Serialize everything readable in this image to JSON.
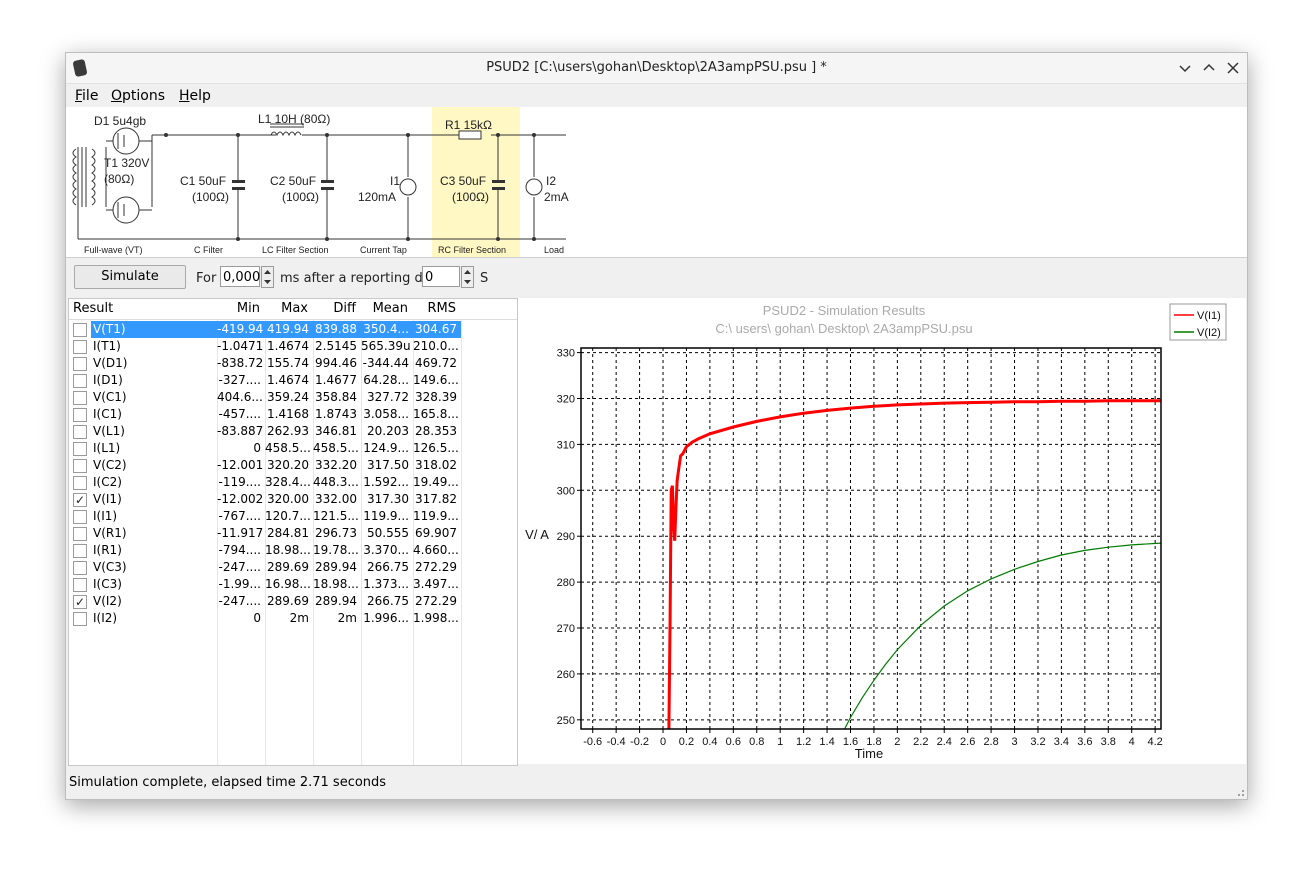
{
  "window": {
    "title": "PSUD2 [C:\\users\\gohan\\Desktop\\2A3ampPSU.psu ] *"
  },
  "menu": [
    {
      "label": "File",
      "mnemonic": "F",
      "rest": "ile"
    },
    {
      "label": "Options",
      "mnemonic": "O",
      "rest": "ptions"
    },
    {
      "label": "Help",
      "mnemonic": "H",
      "rest": "elp"
    }
  ],
  "circuit": {
    "components": {
      "d1": "D1 5u4gb",
      "t1": "T1 320V",
      "t1_r": "(80Ω)",
      "l1": "L1 10H (80Ω)",
      "r1": "R1 15kΩ",
      "c1": "C1 50uF",
      "c1_r": "(100Ω)",
      "c2": "C2 50uF",
      "c2_r": "(100Ω)",
      "i1": "I1",
      "i1_v": "120mA",
      "c3": "C3 50uF",
      "c3_r": "(100Ω)",
      "i2": "I2",
      "i2_v": "2mA"
    },
    "sections": {
      "fullwave": "Full-wave (VT)",
      "cfilter": "C Filter",
      "lcfilter": "LC Filter Section",
      "currenttap": "Current Tap",
      "rcfilter": "RC Filter Section",
      "load": "Load"
    }
  },
  "toolbar": {
    "simulate_label": "Simulate",
    "for_label": "For",
    "for_value": "0,000",
    "after_label": "ms after a reporting dela",
    "delay_value": "0",
    "unit_label": "S"
  },
  "table": {
    "headers": [
      "Result",
      "Min",
      "Max",
      "Diff",
      "Mean",
      "RMS"
    ],
    "rows": [
      {
        "name": "V(T1)",
        "checked": false,
        "selected": true,
        "min": "-419.94",
        "max": "419.94",
        "diff": "839.88",
        "mean": "350.4...",
        "rms": "304.67"
      },
      {
        "name": "I(T1)",
        "checked": false,
        "selected": false,
        "min": "-1.0471",
        "max": "1.4674",
        "diff": "2.5145",
        "mean": "565.39u",
        "rms": "210.0..."
      },
      {
        "name": "V(D1)",
        "checked": false,
        "selected": false,
        "min": "-838.72",
        "max": "155.74",
        "diff": "994.46",
        "mean": "-344.44",
        "rms": "469.72"
      },
      {
        "name": "I(D1)",
        "checked": false,
        "selected": false,
        "min": "-327....",
        "max": "1.4674",
        "diff": "1.4677",
        "mean": "64.28...",
        "rms": "149.6..."
      },
      {
        "name": "V(C1)",
        "checked": false,
        "selected": false,
        "min": "404.6...",
        "max": "359.24",
        "diff": "358.84",
        "mean": "327.72",
        "rms": "328.39"
      },
      {
        "name": "I(C1)",
        "checked": false,
        "selected": false,
        "min": "-457....",
        "max": "1.4168",
        "diff": "1.8743",
        "mean": "3.058...",
        "rms": "165.8..."
      },
      {
        "name": "V(L1)",
        "checked": false,
        "selected": false,
        "min": "-83.887",
        "max": "262.93",
        "diff": "346.81",
        "mean": "20.203",
        "rms": "28.353"
      },
      {
        "name": "I(L1)",
        "checked": false,
        "selected": false,
        "min": "0",
        "max": "458.5...",
        "diff": "458.5...",
        "mean": "124.9...",
        "rms": "126.5..."
      },
      {
        "name": "V(C2)",
        "checked": false,
        "selected": false,
        "min": "-12.001",
        "max": "320.20",
        "diff": "332.20",
        "mean": "317.50",
        "rms": "318.02"
      },
      {
        "name": "I(C2)",
        "checked": false,
        "selected": false,
        "min": "-119....",
        "max": "328.4...",
        "diff": "448.3...",
        "mean": "1.592...",
        "rms": "19.49..."
      },
      {
        "name": "V(I1)",
        "checked": true,
        "selected": false,
        "min": "-12.002",
        "max": "320.00",
        "diff": "332.00",
        "mean": "317.30",
        "rms": "317.82"
      },
      {
        "name": "I(I1)",
        "checked": false,
        "selected": false,
        "min": "-767....",
        "max": "120.7...",
        "diff": "121.5...",
        "mean": "119.9...",
        "rms": "119.9..."
      },
      {
        "name": "V(R1)",
        "checked": false,
        "selected": false,
        "min": "-11.917",
        "max": "284.81",
        "diff": "296.73",
        "mean": "50.555",
        "rms": "69.907"
      },
      {
        "name": "I(R1)",
        "checked": false,
        "selected": false,
        "min": "-794....",
        "max": "18.98...",
        "diff": "19.78...",
        "mean": "3.370...",
        "rms": "4.660..."
      },
      {
        "name": "V(C3)",
        "checked": false,
        "selected": false,
        "min": "-247....",
        "max": "289.69",
        "diff": "289.94",
        "mean": "266.75",
        "rms": "272.29"
      },
      {
        "name": "I(C3)",
        "checked": false,
        "selected": false,
        "min": "-1.99...",
        "max": "16.98...",
        "diff": "18.98...",
        "mean": "1.373...",
        "rms": "3.497..."
      },
      {
        "name": "V(I2)",
        "checked": true,
        "selected": false,
        "min": "-247....",
        "max": "289.69",
        "diff": "289.94",
        "mean": "266.75",
        "rms": "272.29"
      },
      {
        "name": "I(I2)",
        "checked": false,
        "selected": false,
        "min": "0",
        "max": "2m",
        "diff": "2m",
        "mean": "1.996...",
        "rms": "1.998..."
      }
    ]
  },
  "chart_data": {
    "type": "line",
    "title": "PSUD2 - Simulation Results",
    "subtitle": "C:\\ users\\ gohan\\ Desktop\\ 2A3ampPSU.psu",
    "xlabel": "Time",
    "ylabel": "V/ A",
    "xlim": [
      -0.7,
      4.25
    ],
    "ylim": [
      248,
      331
    ],
    "xticks": [
      "-0.6",
      "-0.4",
      "-0.2",
      "0",
      "0.2",
      "0.4",
      "0.6",
      "0.8",
      "1",
      "1.2",
      "1.4",
      "1.6",
      "1.8",
      "2",
      "2.2",
      "2.4",
      "2.6",
      "2.8",
      "3",
      "3.2",
      "3.4",
      "3.6",
      "3.8",
      "4",
      "4.2"
    ],
    "yticks": [
      "250",
      "260",
      "270",
      "280",
      "290",
      "300",
      "310",
      "320",
      "330"
    ],
    "grid": true,
    "legend_position": "top-right-outside",
    "series": [
      {
        "name": "V(I1)",
        "color": "#ff0000",
        "x": [
          0.05,
          0.06,
          0.07,
          0.08,
          0.09,
          0.1,
          0.11,
          0.12,
          0.13,
          0.15,
          0.17,
          0.2,
          0.25,
          0.3,
          0.4,
          0.6,
          0.8,
          1.0,
          1.2,
          1.4,
          1.6,
          1.8,
          2.0,
          2.2,
          2.4,
          2.6,
          2.8,
          3.0,
          3.2,
          3.4,
          3.6,
          3.8,
          4.0,
          4.25
        ],
        "y": [
          248,
          272,
          300,
          301,
          292,
          289,
          296,
          302,
          304,
          307.5,
          308,
          309.5,
          310.5,
          311.2,
          312.3,
          313.8,
          315.0,
          316.0,
          316.8,
          317.4,
          317.9,
          318.3,
          318.6,
          318.8,
          319.0,
          319.1,
          319.2,
          319.3,
          319.3,
          319.4,
          319.4,
          319.5,
          319.5,
          319.5
        ]
      },
      {
        "name": "V(I2)",
        "color": "#007a00",
        "x": [
          1.55,
          1.6,
          1.7,
          1.8,
          1.9,
          2.0,
          2.2,
          2.4,
          2.6,
          2.8,
          3.0,
          3.2,
          3.4,
          3.6,
          3.8,
          4.0,
          4.25
        ],
        "y": [
          248,
          250.5,
          254.8,
          258.6,
          262.1,
          265.3,
          270.6,
          274.8,
          278.1,
          280.7,
          282.8,
          284.5,
          285.9,
          286.9,
          287.6,
          288.1,
          288.5
        ]
      }
    ]
  },
  "status": {
    "text": "Simulation complete, elapsed time 2.71 seconds"
  }
}
